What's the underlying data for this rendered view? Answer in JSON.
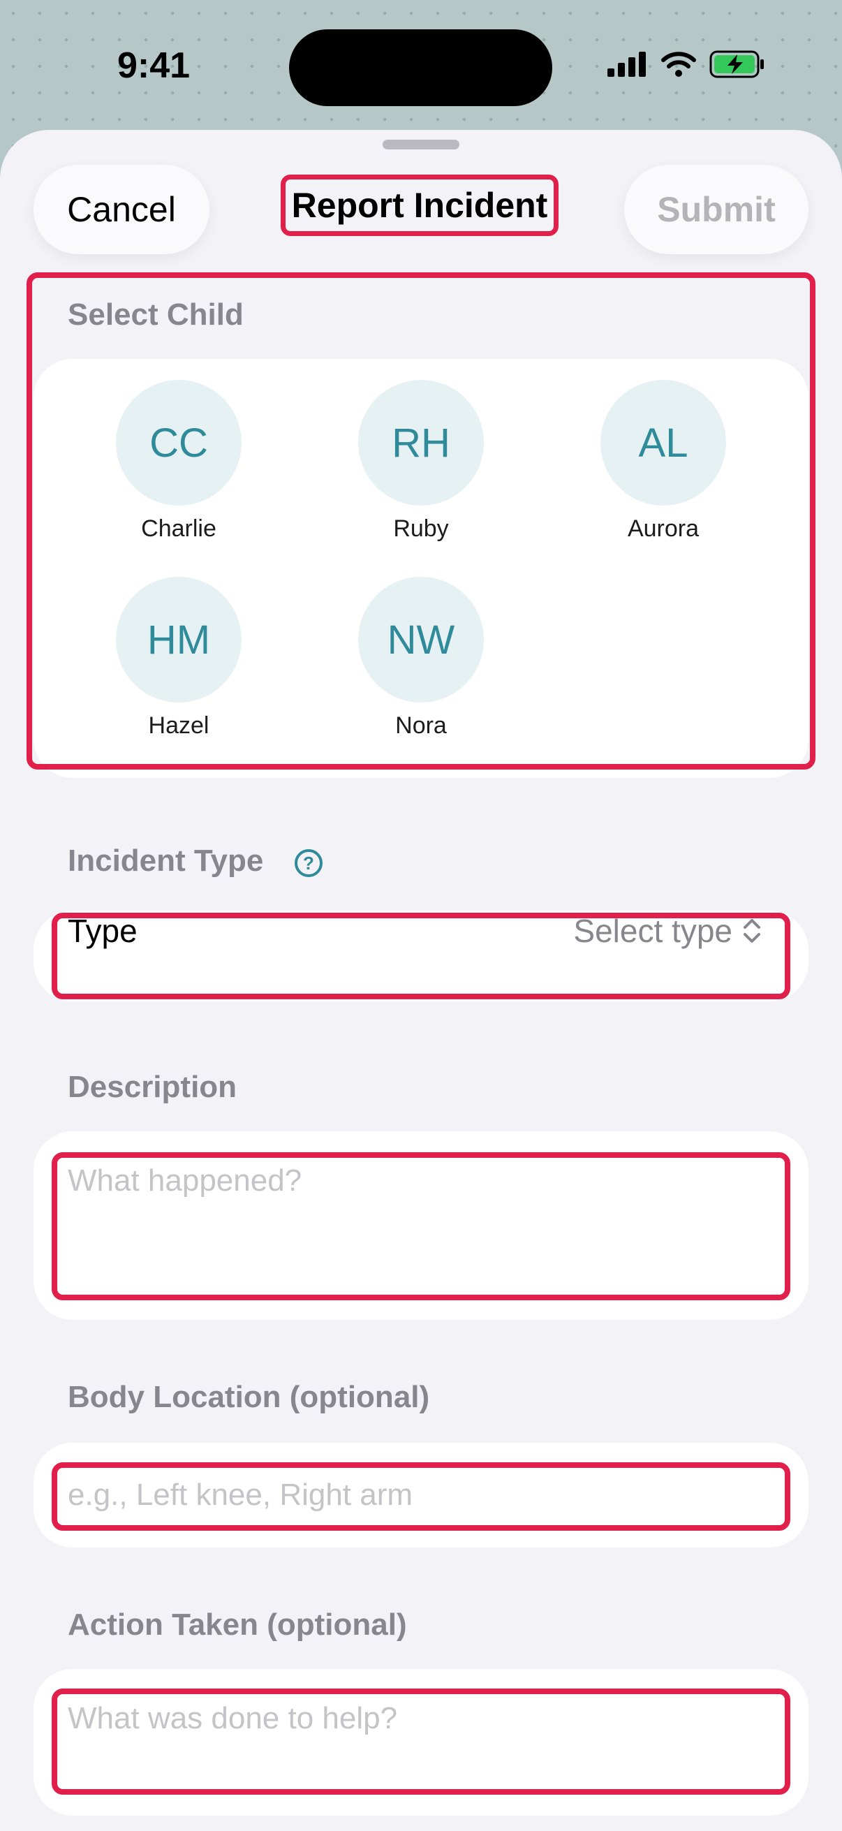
{
  "status": {
    "time": "9:41"
  },
  "header": {
    "cancel": "Cancel",
    "title": "Report Incident",
    "submit": "Submit"
  },
  "select_child": {
    "label": "Select Child",
    "children": [
      {
        "initials": "CC",
        "name": "Charlie"
      },
      {
        "initials": "RH",
        "name": "Ruby"
      },
      {
        "initials": "AL",
        "name": "Aurora"
      },
      {
        "initials": "HM",
        "name": "Hazel"
      },
      {
        "initials": "NW",
        "name": "Nora"
      }
    ]
  },
  "incident_type": {
    "label": "Incident Type",
    "field_label": "Type",
    "value": "Select type"
  },
  "description": {
    "label": "Description",
    "placeholder": "What happened?"
  },
  "body_location": {
    "label": "Body Location (optional)",
    "placeholder": "e.g., Left knee, Right arm"
  },
  "action_taken": {
    "label": "Action Taken (optional)",
    "placeholder": "What was done to help?"
  },
  "colors": {
    "accent": "#2f8a99",
    "highlight": "#e0204a",
    "avatar_bg": "#e6f1f3"
  }
}
